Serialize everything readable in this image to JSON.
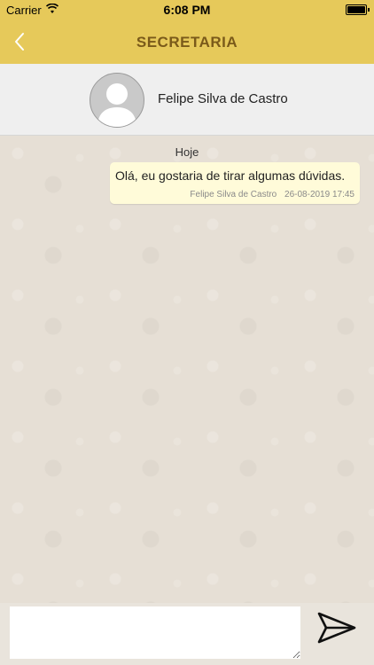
{
  "status_bar": {
    "carrier": "Carrier",
    "time": "6:08 PM"
  },
  "nav": {
    "title": "SECRETARIA",
    "back_icon": "chevron-left-icon"
  },
  "contact": {
    "name": "Felipe Silva de Castro",
    "avatar_icon": "avatar-placeholder-icon"
  },
  "chat": {
    "date_separator": "Hoje",
    "messages": [
      {
        "text": "Olá, eu gostaria de tirar algumas dúvidas.",
        "author": "Felipe Silva de Castro",
        "timestamp": "26-08-2019 17:45"
      }
    ]
  },
  "composer": {
    "input_value": "",
    "placeholder": "",
    "send_icon": "send-paper-plane-icon"
  },
  "colors": {
    "accent": "#e6c95a",
    "title": "#7a5a1a",
    "bubble": "#fffbd9",
    "chat_bg": "#e6dfd5"
  }
}
